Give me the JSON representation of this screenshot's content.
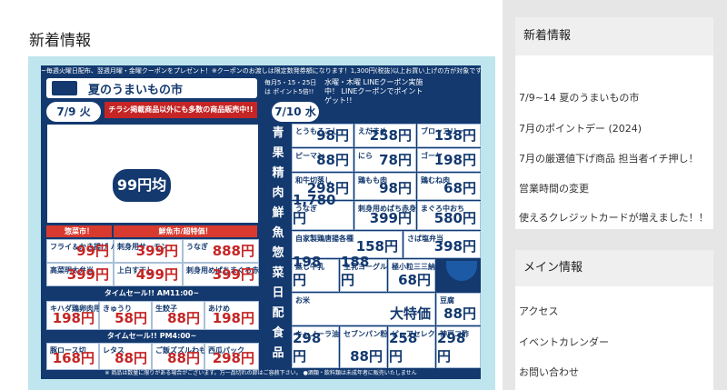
{
  "main": {
    "title": "新着情報",
    "flyer": {
      "top_line": "~毎週火曜日配布、翌週月曜・金曜クーポンをプレゼント！※クーポンのお渡しは限定数発券額になります！1,300円(税抜)以上お買い上げの方が対象です！",
      "header_title": "夏のうまいもの市",
      "left_date": "7/9 火",
      "banner": "チラシ掲載商品以外にも多数の商品販売中!!",
      "sale_price": "99円均一",
      "section_deli": "惣菜市！",
      "section_fresh": "鮮魚市/超特価！",
      "timesale_1": "タイムセール!! AM11:00~",
      "timesale_2": "タイムセール!! PM4:00~",
      "right_date": "7/10 水",
      "right_points": "毎月5・15・25日は ポイント5倍!!",
      "right_line": "水曜・木曜 LINEクーポン実施中！ LINEクーポンでポイントゲット!!",
      "vertical_label": "青果 精肉 鮮魚 惣菜 日配 食品",
      "footer": "※ 商品は数量に限りがある場合がございます。万一品切れの節はご容赦下さい。 ●酒類・飲料類は未成年者に販売いたしません",
      "items": [
        {
          "label": "とうもろこし",
          "price": "98円"
        },
        {
          "label": "えだまめ",
          "price": "258円"
        },
        {
          "label": "ブロッコリー",
          "price": "138円"
        },
        {
          "label": "ピーマン",
          "price": "88円"
        },
        {
          "label": "にら",
          "price": "78円"
        },
        {
          "label": "ゴーヤ",
          "price": "198円"
        },
        {
          "label": "和牛切落し",
          "price": "298円"
        },
        {
          "label": "鶏もも肉",
          "price": "98円"
        },
        {
          "label": "鶏むね肉",
          "price": "68円"
        },
        {
          "label": "うなぎ",
          "price": "1,780円"
        },
        {
          "label": "刺身用めばち赤身用ブロック",
          "price": "399円"
        },
        {
          "label": "まぐろ中おち",
          "price": "580円"
        },
        {
          "label": "自家製鶏唐揚各種",
          "price": "158円"
        },
        {
          "label": "さば塩弁当",
          "price": "398円"
        },
        {
          "label": "蒸し牛乳",
          "price": "198円"
        },
        {
          "label": "生乳ヨーグルト",
          "price": "188円"
        },
        {
          "label": "極小粒三三納豆",
          "price": "68円"
        },
        {
          "label": "豆腐",
          "price": "88円"
        },
        {
          "label": "キャノーラ油",
          "price": "298円"
        },
        {
          "label": "セブンパン粉",
          "price": "88円"
        },
        {
          "label": "ピュアセレクト マヨネーズ",
          "price": "258円"
        },
        {
          "label": "神戸コ酢",
          "price": "298円"
        },
        {
          "label": "お米",
          "price": "大特価"
        }
      ],
      "left_items": [
        {
          "label": "フライ＆かき揚げ バイキング",
          "price": "99円"
        },
        {
          "label": "刺身用サーモン",
          "price": "399円"
        },
        {
          "label": "うなぎ",
          "price": "888円"
        },
        {
          "label": "高菜明太弁当",
          "price": "399円"
        },
        {
          "label": "上白す干し",
          "price": "499円"
        },
        {
          "label": "刺身用めばちまぐろ赤身用ブロック",
          "price": "399円"
        },
        {
          "label": "キハダ鶏卵肉用",
          "price": "198円"
        },
        {
          "label": "きゅうり",
          "price": "58円"
        },
        {
          "label": "生餃子",
          "price": "88円"
        },
        {
          "label": "あけめ",
          "price": "198円"
        },
        {
          "label": "豚ロース切",
          "price": "168円"
        },
        {
          "label": "レタス",
          "price": "88円"
        },
        {
          "label": "ご飯ズズルわもす",
          "price": "88円"
        },
        {
          "label": "西瓜パック",
          "price": "298円"
        }
      ]
    }
  },
  "sidebar": {
    "news_title": "新着情報",
    "news_items": [
      "7/9~14 夏のうまいもの市",
      "7月のポイントデー (2024)",
      "7月の厳選値下げ商品 担当者イチ押し！",
      "営業時間の変更",
      "使えるクレジットカードが増えました！！"
    ],
    "info_title": "メイン情報",
    "info_items": [
      "アクセス",
      "イベントカレンダー",
      "お問い合わせ"
    ]
  }
}
